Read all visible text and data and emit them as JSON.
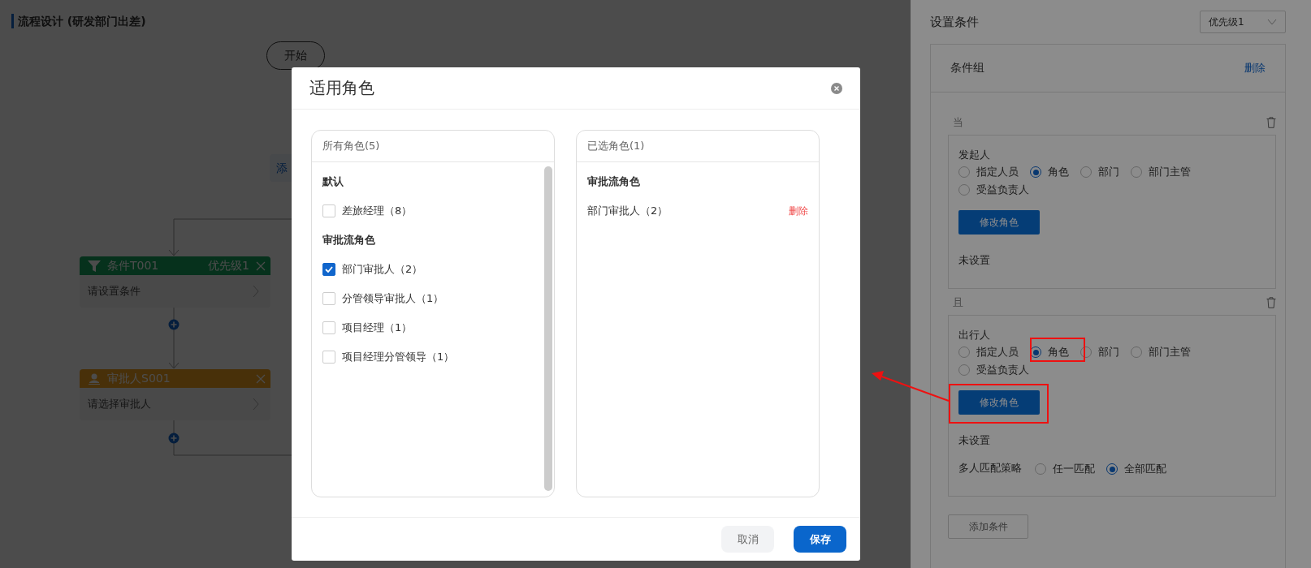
{
  "canvas": {
    "title": "流程设计 (研发部门出差)",
    "start_node": "开始",
    "add_button": "添",
    "nodes": [
      {
        "kind": "condition",
        "title": "条件T001",
        "priority": "优先级1",
        "body": "请设置条件"
      },
      {
        "kind": "approver",
        "title": "审批人S001",
        "body": "请选择审批人"
      }
    ]
  },
  "panel": {
    "title": "设置条件",
    "priority_select": {
      "value": "优先级1"
    },
    "group": {
      "title": "条件组",
      "delete_link": "删除",
      "conditions": [
        {
          "connector": "当",
          "field": "发起人",
          "options": [
            {
              "label": "指定人员",
              "selected": false
            },
            {
              "label": "角色",
              "selected": true
            },
            {
              "label": "部门",
              "selected": false
            },
            {
              "label": "部门主管",
              "selected": false
            },
            {
              "label": "受益负责人",
              "selected": false
            }
          ],
          "button": "修改角色",
          "status": "未设置"
        },
        {
          "connector": "且",
          "field": "出行人",
          "options": [
            {
              "label": "指定人员",
              "selected": false
            },
            {
              "label": "角色",
              "selected": true
            },
            {
              "label": "部门",
              "selected": false
            },
            {
              "label": "部门主管",
              "selected": false
            },
            {
              "label": "受益负责人",
              "selected": false
            }
          ],
          "button": "修改角色",
          "status": "未设置",
          "match_strategy": {
            "label": "多人匹配策略",
            "options": [
              {
                "label": "任一匹配",
                "selected": false
              },
              {
                "label": "全部匹配",
                "selected": true
              }
            ]
          }
        }
      ],
      "add_condition_button": "添加条件"
    }
  },
  "modal": {
    "title": "适用角色",
    "all_roles": {
      "header": "所有角色(5)",
      "groups": [
        {
          "name": "默认",
          "items": [
            {
              "label": "差旅经理（8）",
              "checked": false
            }
          ]
        },
        {
          "name": "审批流角色",
          "items": [
            {
              "label": "部门审批人（2）",
              "checked": true
            },
            {
              "label": "分管领导审批人（1）",
              "checked": false
            },
            {
              "label": "项目经理（1）",
              "checked": false
            },
            {
              "label": "项目经理分管领导（1）",
              "checked": false
            }
          ]
        }
      ]
    },
    "selected_roles": {
      "header": "已选角色(1)",
      "groups": [
        {
          "name": "审批流角色",
          "items": [
            {
              "label": "部门审批人（2）",
              "action": "删除"
            }
          ]
        }
      ]
    },
    "buttons": [
      {
        "label": "取消",
        "kind": "secondary"
      },
      {
        "label": "保存",
        "kind": "primary"
      }
    ]
  }
}
